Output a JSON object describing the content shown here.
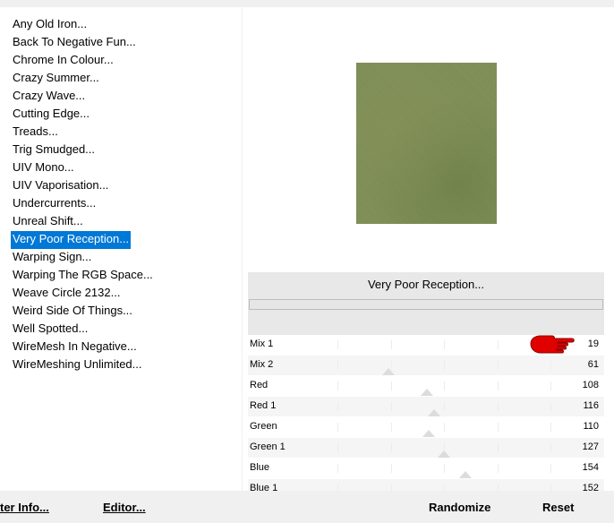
{
  "filters": [
    {
      "label": "Any Old Iron..."
    },
    {
      "label": "Back To Negative Fun..."
    },
    {
      "label": "Chrome In Colour..."
    },
    {
      "label": "Crazy Summer..."
    },
    {
      "label": "Crazy Wave..."
    },
    {
      "label": "Cutting Edge..."
    },
    {
      "label": "Treads..."
    },
    {
      "label": "Trig Smudged..."
    },
    {
      "label": "UIV Mono..."
    },
    {
      "label": "UIV Vaporisation..."
    },
    {
      "label": "Undercurrents..."
    },
    {
      "label": "Unreal Shift..."
    },
    {
      "label": "Very Poor Reception..."
    },
    {
      "label": "Warping Sign..."
    },
    {
      "label": "Warping The RGB Space..."
    },
    {
      "label": "Weave Circle 2132..."
    },
    {
      "label": "Weird Side Of Things..."
    },
    {
      "label": "Well Spotted..."
    },
    {
      "label": "WireMesh In Negative..."
    },
    {
      "label": "WireMeshing Unlimited..."
    }
  ],
  "selected_filter": "Very Poor Reception...",
  "bottom_bar": {
    "filter_info": "ter Info...",
    "editor": "Editor...",
    "randomize": "Randomize",
    "reset": "Reset"
  },
  "preview": {
    "dominant_color": "#7f8f55"
  },
  "controls": [
    {
      "label": "Mix 1",
      "value": "19",
      "level": 0.075
    },
    {
      "label": "Mix 2",
      "value": "61",
      "level": 0.24
    },
    {
      "label": "Red",
      "value": "108",
      "level": 0.42
    },
    {
      "label": "Red 1",
      "value": "116",
      "level": 0.455
    },
    {
      "label": "Green",
      "value": "110",
      "level": 0.43
    },
    {
      "label": "Green 1",
      "value": "127",
      "level": 0.5
    },
    {
      "label": "Blue",
      "value": "154",
      "level": 0.6
    },
    {
      "label": "Blue 1",
      "value": "152",
      "level": 0.595
    }
  ],
  "colors": {
    "selection": "#0078d7",
    "pointer_hand": "#e00000"
  }
}
